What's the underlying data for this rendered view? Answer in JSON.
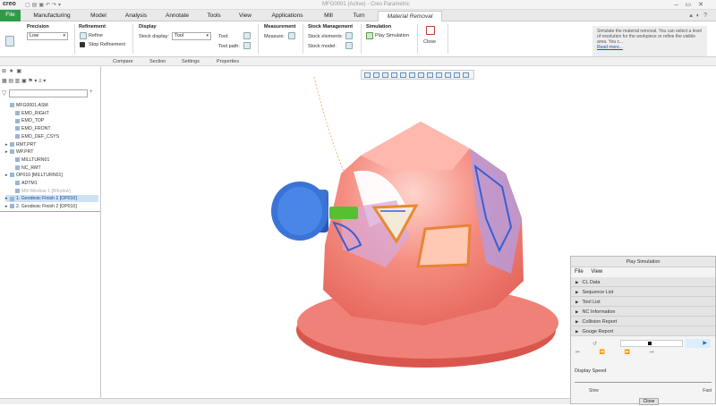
{
  "app": {
    "logo": "creo",
    "window_title": "MFG0001 (Active) - Creo Parametric"
  },
  "tabs": [
    {
      "label": "File"
    },
    {
      "label": "Manufacturing"
    },
    {
      "label": "Model"
    },
    {
      "label": "Analysis"
    },
    {
      "label": "Annotate"
    },
    {
      "label": "Tools"
    },
    {
      "label": "View"
    },
    {
      "label": "Applications"
    },
    {
      "label": "Mill"
    },
    {
      "label": "Turn"
    },
    {
      "label": "Material Removal"
    }
  ],
  "ribbon": {
    "precision": {
      "title": "Precision",
      "value": "Low"
    },
    "refinement": {
      "title": "Refinement",
      "refine": "Refine",
      "stop": "Stop Refinement"
    },
    "display": {
      "title": "Display",
      "stock_display_label": "Stock display:",
      "stock_display_value": "Tool",
      "tool_label": "Tool:",
      "tool_path_label": "Tool path:"
    },
    "measurement": {
      "title": "Measurement",
      "measure_label": "Measure:"
    },
    "stock_mgmt": {
      "title": "Stock Management",
      "stock_elements_label": "Stock elements:",
      "stock_model_label": "Stock model:"
    },
    "simulation": {
      "title": "Simulation",
      "play_label": "Play Simulation"
    },
    "close_label": "Close",
    "help_text": "Simulate the material removal. You can select a level of resolution for the workpiece or refine the visible area. You c...",
    "help_more": "Read more..."
  },
  "subtabs": [
    "Compare",
    "Section",
    "Settings",
    "Properties"
  ],
  "tree": [
    {
      "label": "MFG0001.ASM",
      "indent": 0,
      "arrow": "",
      "state": "normal"
    },
    {
      "label": "EMO_RIGHT",
      "indent": 1,
      "arrow": "",
      "state": "normal"
    },
    {
      "label": "EMO_TOP",
      "indent": 1,
      "arrow": "",
      "state": "normal"
    },
    {
      "label": "EMO_FRONT",
      "indent": 1,
      "arrow": "",
      "state": "normal"
    },
    {
      "label": "EMO_DEF_CSYS",
      "indent": 1,
      "arrow": "",
      "state": "normal"
    },
    {
      "label": "RMT.PRT",
      "indent": 0,
      "arrow": "▸",
      "state": "normal"
    },
    {
      "label": "WP.PRT",
      "indent": 0,
      "arrow": "▸",
      "state": "normal"
    },
    {
      "label": "MILLTURN01",
      "indent": 1,
      "arrow": "",
      "state": "normal"
    },
    {
      "label": "NC_RMT",
      "indent": 1,
      "arrow": "",
      "state": "normal"
    },
    {
      "label": "OP010 [MILLTURN01]",
      "indent": 0,
      "arrow": "▸",
      "state": "normal"
    },
    {
      "label": "ADTM1",
      "indent": 1,
      "arrow": "",
      "state": "normal"
    },
    {
      "label": "Mill Window 1 [Window]",
      "indent": 1,
      "arrow": "",
      "state": "dim"
    },
    {
      "label": "1. Geodesic Finish 1 [OP010]",
      "indent": 0,
      "arrow": "▸",
      "state": "selected"
    },
    {
      "label": "2. Geodesic Finish 2 [OP010]",
      "indent": 0,
      "arrow": "▸",
      "state": "normal"
    }
  ],
  "sim": {
    "title": "Play Simulation",
    "menu": [
      "File",
      "View"
    ],
    "sections": [
      "CL Data",
      "Sequence List",
      "Tool List",
      "NC Information",
      "Collision Report",
      "Gouge Report"
    ],
    "display_speed_label": "Display Speed",
    "slow": "Slow",
    "fast": "Fast",
    "close_label": "Close"
  },
  "colors": {
    "file_tab": "#2e9b48",
    "part": "#f3877d",
    "tool": "#3a74d6",
    "spindle": "#58c030",
    "selection": "#cfe1f5"
  }
}
